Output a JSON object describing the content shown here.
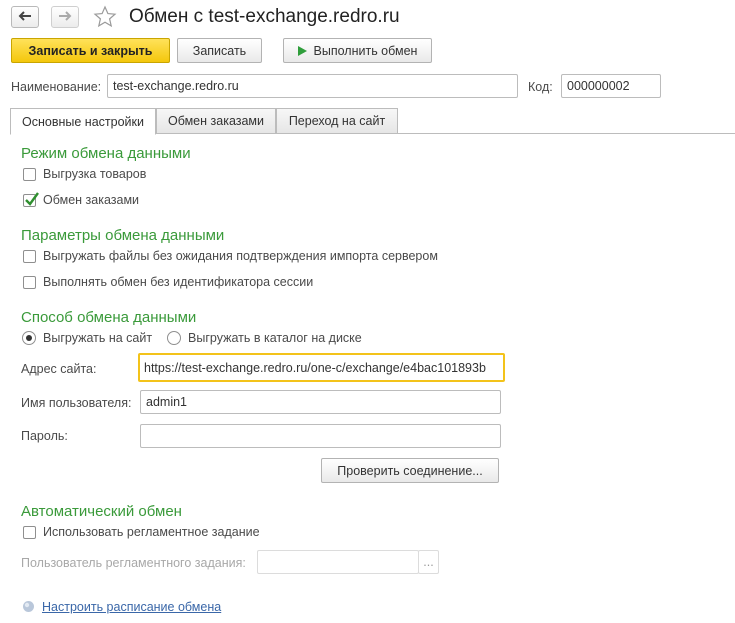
{
  "window": {
    "title": "Обмен с test-exchange.redro.ru"
  },
  "toolbar": {
    "save_close_label": "Записать и закрыть",
    "save_label": "Записать",
    "run_label": "Выполнить обмен"
  },
  "header_fields": {
    "name_label": "Наименование:",
    "name_value": "test-exchange.redro.ru",
    "code_label": "Код:",
    "code_value": "000000002"
  },
  "tabs": [
    {
      "label": "Основные настройки",
      "active": true
    },
    {
      "label": "Обмен заказами",
      "active": false
    },
    {
      "label": "Переход на сайт",
      "active": false
    }
  ],
  "exchange_mode": {
    "title": "Режим обмена данными",
    "goods_label": "Выгрузка товаров",
    "goods_checked": false,
    "orders_label": "Обмен заказами",
    "orders_checked": true
  },
  "exchange_params": {
    "title": "Параметры обмена данными",
    "no_wait_label": "Выгружать файлы без ожидания подтверждения импорта сервером",
    "no_wait_checked": false,
    "no_session_label": "Выполнять обмен без идентификатора сессии",
    "no_session_checked": false
  },
  "exchange_method": {
    "title": "Способ обмена данными",
    "radio_site_label": "Выгружать на сайт",
    "radio_disk_label": "Выгружать в каталог на диске",
    "selected": "site",
    "site_address_label": "Адрес сайта:",
    "site_address_value": "https://test-exchange.redro.ru/one-c/exchange/e4bac101893b",
    "username_label": "Имя пользователя:",
    "username_value": "admin1",
    "password_label": "Пароль:",
    "password_value": "",
    "check_connection_label": "Проверить соединение..."
  },
  "auto_exchange": {
    "title": "Автоматический обмен",
    "use_job_label": "Использовать регламентное задание",
    "use_job_checked": false,
    "job_user_label": "Пользователь регламентного задания:",
    "job_user_value": "",
    "select_button_label": "...",
    "schedule_link": "Настроить расписание обмена"
  }
}
